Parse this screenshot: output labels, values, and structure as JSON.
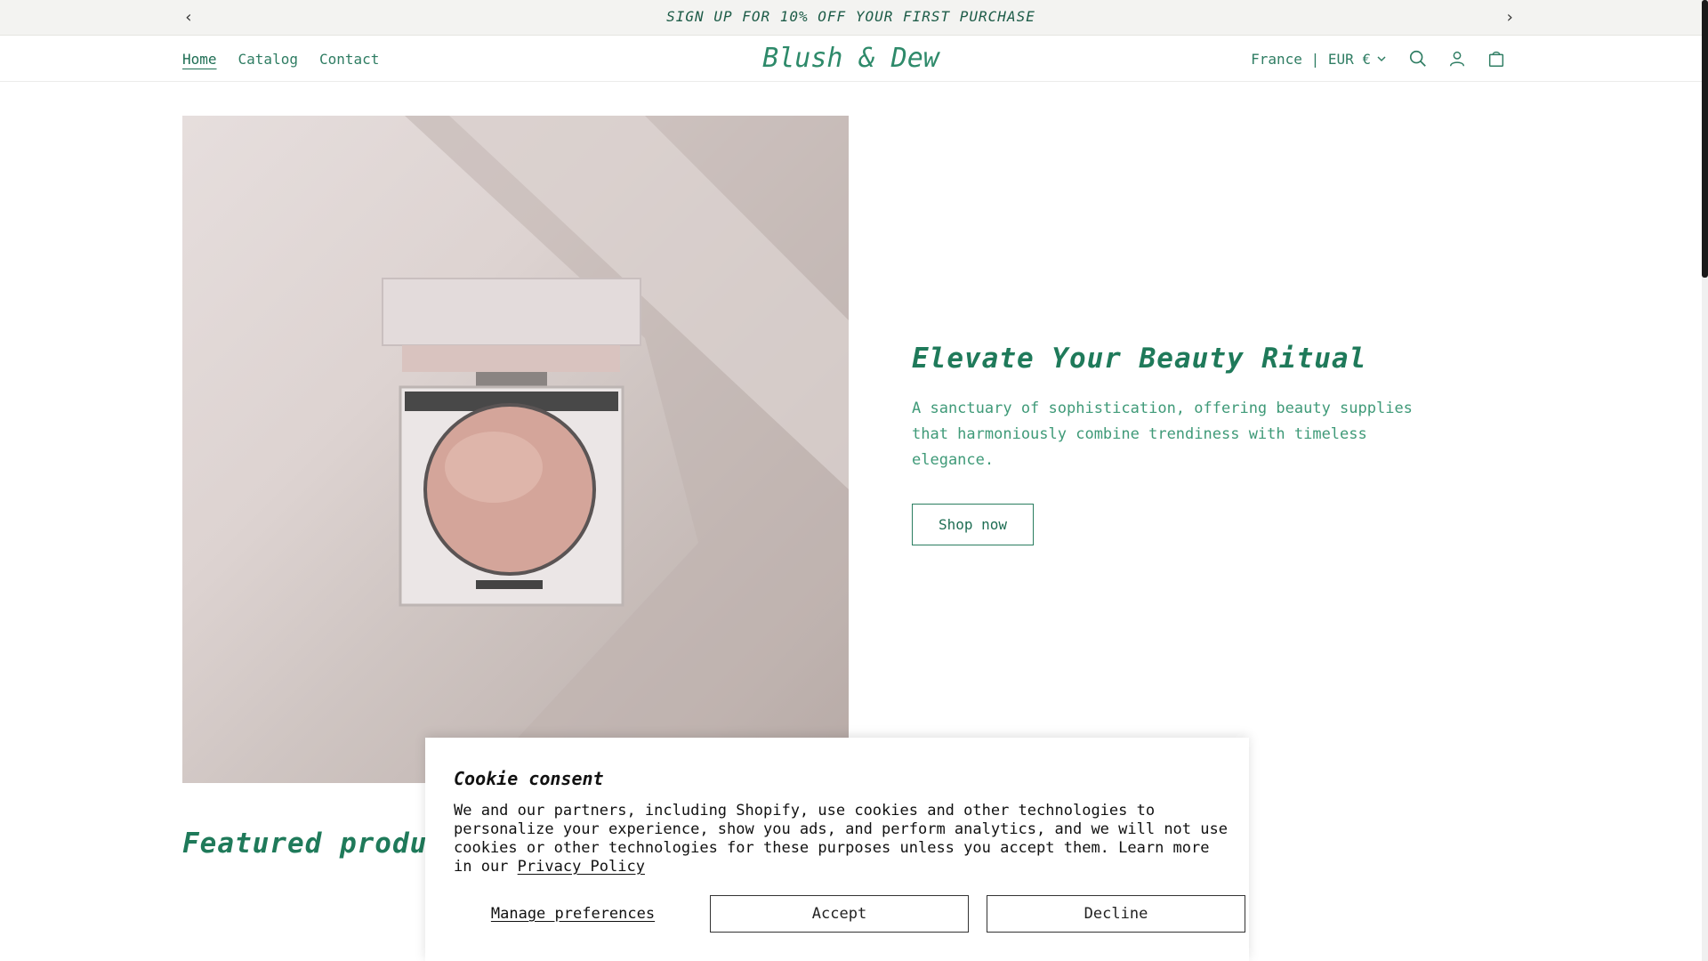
{
  "announcement": {
    "message": "SIGN UP FOR 10% OFF YOUR FIRST PURCHASE",
    "prev_icon": "chevron-left-icon",
    "next_icon": "chevron-right-icon"
  },
  "header": {
    "nav": [
      {
        "label": "Home",
        "active": true
      },
      {
        "label": "Catalog",
        "active": false
      },
      {
        "label": "Contact",
        "active": false
      }
    ],
    "logo": "Blush & Dew",
    "locale": "France | EUR €",
    "icons": [
      "chevron-down-icon",
      "search-icon",
      "account-icon",
      "cart-icon"
    ]
  },
  "hero": {
    "image_alt": "Pink blush compact on beige background",
    "title": "Elevate Your Beauty Ritual",
    "description": "A sanctuary of sophistication, offering beauty supplies that harmoniously combine trendiness with timeless elegance.",
    "button_label": "Shop now"
  },
  "featured": {
    "title": "Featured products"
  },
  "cookie": {
    "title": "Cookie consent",
    "text": "We and our partners, including Shopify, use cookies and other technologies to personalize your experience, show you ads, and perform analytics, and we will not use cookies or other technologies for these purposes unless you accept them. Learn more in our ",
    "policy_link": "Privacy Policy",
    "manage_label": "Manage preferences",
    "accept_label": "Accept",
    "decline_label": "Decline"
  },
  "colors": {
    "accent": "#1f7a5a",
    "announcement_bg": "#f3f3f1"
  }
}
